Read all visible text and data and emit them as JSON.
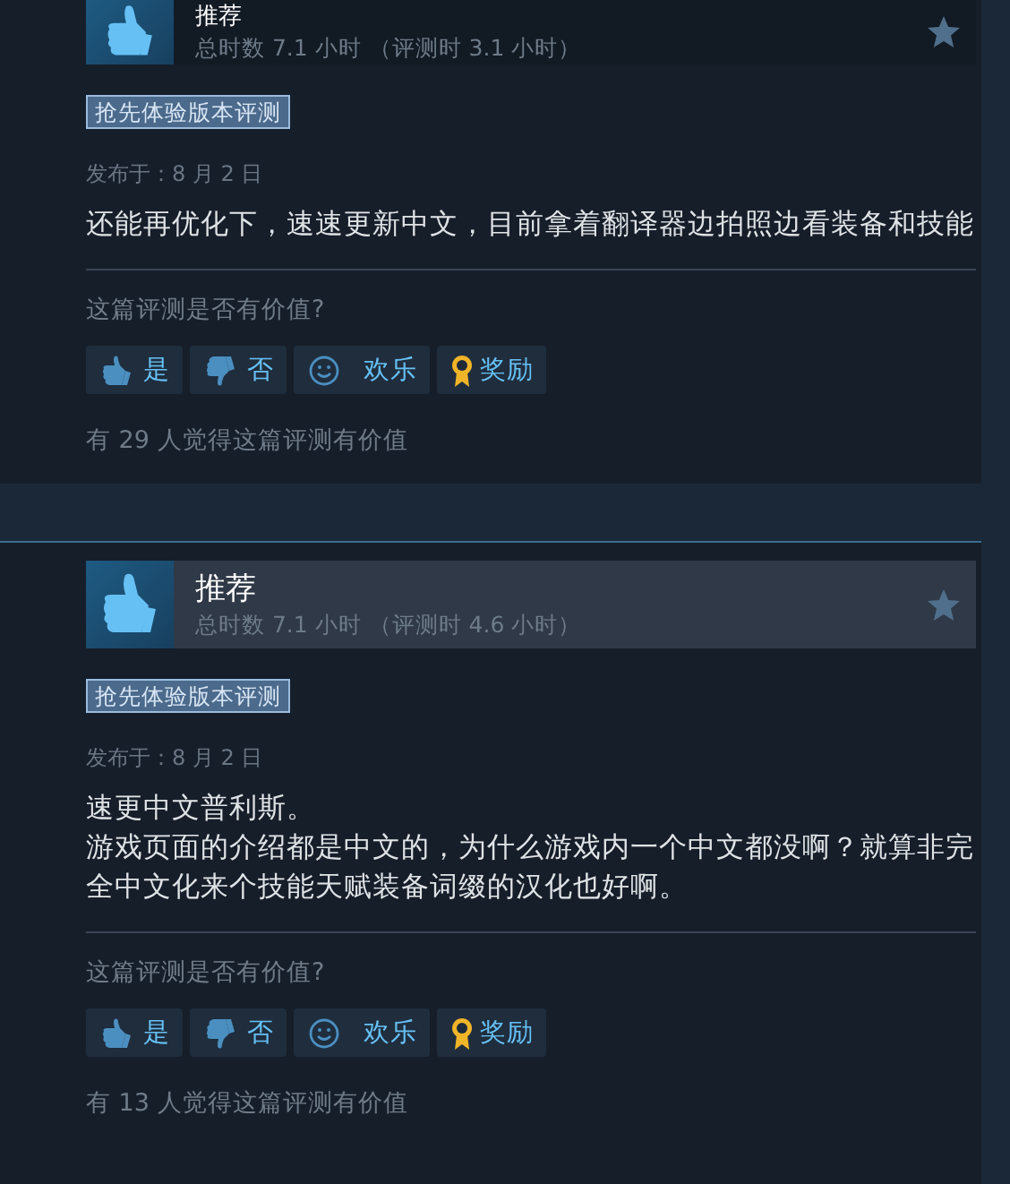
{
  "reviews": [
    {
      "verdict": "推荐",
      "highlighted": false,
      "hours": "总时数 7.1 小时 （评测时 3.1 小时）",
      "tag": "抢先体验版本评测",
      "date": "发布于：8 月 2 日",
      "paragraphs": [
        "还能再优化下，速速更新中文，目前拿着翻译器边拍照边看装备和技能"
      ],
      "helpful_prompt": "这篇评测是否有价值?",
      "buttons": [
        {
          "kind": "yes",
          "label": "是"
        },
        {
          "kind": "no",
          "label": "否"
        },
        {
          "kind": "funny",
          "label": "欢乐"
        },
        {
          "kind": "award",
          "label": "奖励"
        }
      ],
      "helpful_count": "有 29 人觉得这篇评测有价值"
    },
    {
      "verdict": "推荐",
      "highlighted": true,
      "hours": "总时数 7.1 小时 （评测时 4.6 小时）",
      "tag": "抢先体验版本评测",
      "date": "发布于：8 月 2 日",
      "paragraphs": [
        "速更中文普利斯。",
        "游戏页面的介绍都是中文的，为什么游戏内一个中文都没啊？就算非完全中文化来个技能天赋装备词缀的汉化也好啊。"
      ],
      "helpful_prompt": "这篇评测是否有价值?",
      "buttons": [
        {
          "kind": "yes",
          "label": "是"
        },
        {
          "kind": "no",
          "label": "否"
        },
        {
          "kind": "funny",
          "label": "欢乐"
        },
        {
          "kind": "award",
          "label": "奖励"
        }
      ],
      "helpful_count": "有 13 人觉得这篇评测有价值"
    }
  ]
}
